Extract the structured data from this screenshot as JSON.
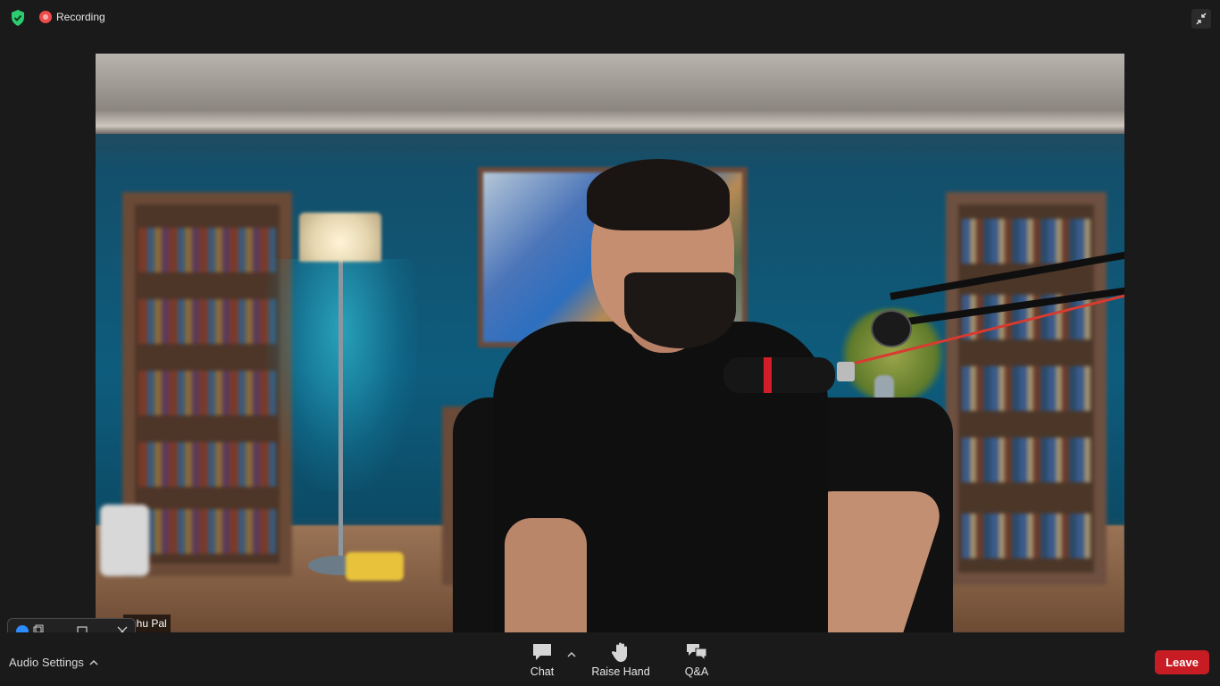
{
  "window": {
    "recording_label": "Recording"
  },
  "video": {
    "participant_name": "gshu Pal"
  },
  "toolbar": {
    "audio_settings_label": "Audio Settings",
    "chat_label": "Chat",
    "raise_hand_label": "Raise Hand",
    "qa_label": "Q&A",
    "leave_label": "Leave"
  },
  "colors": {
    "background": "#1a1a1a",
    "leave_button": "#c81c24",
    "recording_dot": "#f04a4a",
    "shield": "#2ecc71",
    "app_logo": "#2d8cff"
  },
  "icons": {
    "security": "shield-check-icon",
    "recording": "recording-dot-icon",
    "exit_fullscreen": "exit-fullscreen-icon",
    "chat": "chat-bubble-icon",
    "raise_hand": "hand-icon",
    "qa": "qa-bubbles-icon"
  }
}
